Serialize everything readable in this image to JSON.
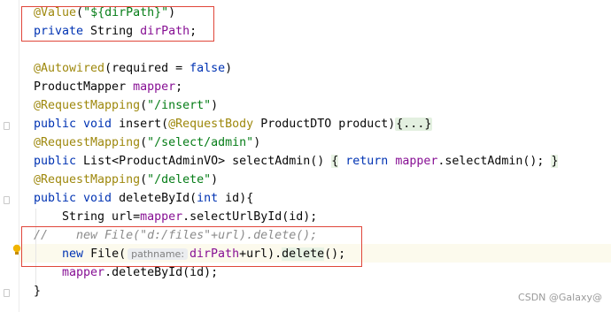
{
  "code": {
    "l1": {
      "ann": "@Value",
      "p1": "(",
      "str": "\"${dirPath}\"",
      "p2": ")"
    },
    "l2": {
      "kw": "private",
      "type": " String ",
      "fld": "dirPath",
      "end": ";"
    },
    "l3": {
      "ann": "@Autowired",
      "rest": "(required = ",
      "kw": "false",
      "end": ")"
    },
    "l4": {
      "type": "ProductMapper ",
      "fld": "mapper",
      "end": ";"
    },
    "l5": {
      "ann": "@RequestMapping",
      "p1": "(",
      "str": "\"/insert\"",
      "p2": ")"
    },
    "l6": {
      "kw": "public void",
      "name": " insert(",
      "ann": "@RequestBody",
      "rest": " ProductDTO product)",
      "fold": "{...}"
    },
    "l7": {
      "ann": "@RequestMapping",
      "p1": "(",
      "str": "\"/select/admin\"",
      "p2": ")"
    },
    "l8": {
      "kw": "public",
      "type": " List<ProductAdminVO> selectAdmin() ",
      "ob": "{",
      "kw2": " return ",
      "fld": "mapper",
      "rest": ".selectAdmin(); ",
      "cb": "}"
    },
    "l9": {
      "ann": "@RequestMapping",
      "p1": "(",
      "str": "\"/delete\"",
      "p2": ")"
    },
    "l10": {
      "kw": "public void",
      "name": " deleteById(",
      "kw2": "int",
      "rest": " id){"
    },
    "l11": {
      "pre": "    String url=",
      "fld": "mapper",
      "rest": ".selectUrlById(id);"
    },
    "l12": {
      "cmt": "//    new File(\"d:/files\"+url).delete();"
    },
    "l13": {
      "pre": "    ",
      "kw": "new",
      "mid": " File(",
      "hint": "pathname:",
      "fld": "dirPath",
      "rest": "+url).",
      "call": "delete",
      "end": "();"
    },
    "l14": {
      "pre": "    ",
      "fld": "mapper",
      "rest": ".deleteById(id);"
    },
    "l15": {
      "text": "}"
    }
  },
  "watermark": "CSDN @Galaxy@"
}
